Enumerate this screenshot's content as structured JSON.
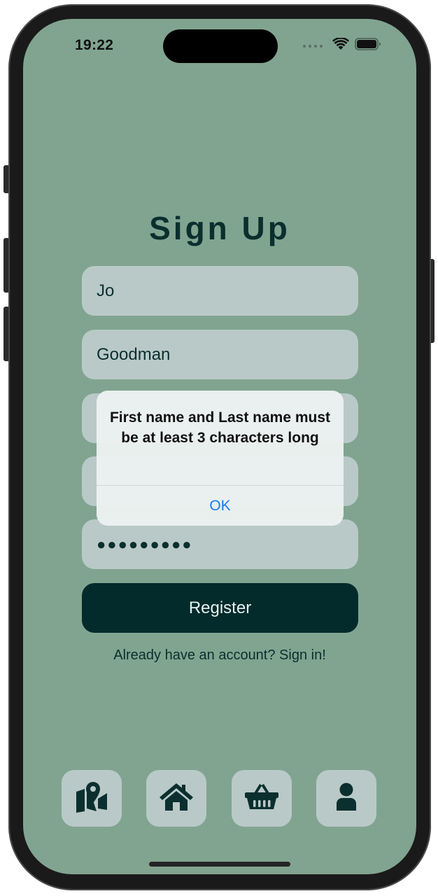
{
  "status_bar": {
    "time": "19:22"
  },
  "page": {
    "title": "Sign Up"
  },
  "form": {
    "first_name_value": "Jo",
    "last_name_value": "Goodman",
    "password_value": "●●●●●●●●●",
    "register_label": "Register",
    "signin_link": "Already have an account? Sign in!"
  },
  "alert": {
    "message": "First name and Last name must be at least 3 characters long",
    "ok_label": "OK"
  },
  "tab_bar": {
    "items": [
      {
        "icon": "map-icon"
      },
      {
        "icon": "home-icon"
      },
      {
        "icon": "basket-icon"
      },
      {
        "icon": "user-icon"
      }
    ]
  },
  "colors": {
    "background": "#81a490",
    "primary_dark": "#032b2c",
    "field": "#b9c9c8",
    "alert_button": "#1a7cf0"
  }
}
